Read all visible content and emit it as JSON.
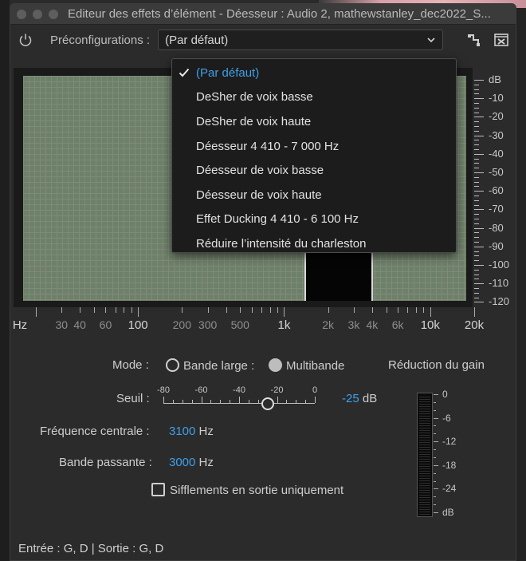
{
  "window": {
    "title": "Editeur des effets d’élément - Déesseur : Audio 2, mathewstanley_dec2022_S..."
  },
  "toolbar": {
    "presets_label": "Préconfigurations :",
    "selected_preset": "(Par défaut)"
  },
  "presets_menu": {
    "items": [
      {
        "label": "(Par défaut)",
        "selected": true
      },
      {
        "label": "DeSher de voix basse"
      },
      {
        "label": "DeSher de voix haute"
      },
      {
        "label": "Déesseur 4 410 - 7 000 Hz"
      },
      {
        "label": "Déesseur de voix basse"
      },
      {
        "label": "Déesseur de voix haute"
      },
      {
        "label": "Effet Ducking 4 410 - 6 100 Hz"
      },
      {
        "label": "Réduire l’intensité du charleston"
      }
    ]
  },
  "graph": {
    "db_labels": [
      "dB",
      "-10",
      "-20",
      "-30",
      "-40",
      "-50",
      "-60",
      "-70",
      "-80",
      "-90",
      "-100",
      "-110",
      "-120"
    ],
    "freq_labels": [
      {
        "text": "Hz",
        "major": true
      },
      {
        "text": "30",
        "major": false
      },
      {
        "text": "40",
        "major": false
      },
      {
        "text": "60",
        "major": false
      },
      {
        "text": "100",
        "major": true
      },
      {
        "text": "200",
        "major": false
      },
      {
        "text": "300",
        "major": false
      },
      {
        "text": "500",
        "major": false
      },
      {
        "text": "1k",
        "major": true
      },
      {
        "text": "2k",
        "major": false
      },
      {
        "text": "3k",
        "major": false
      },
      {
        "text": "4k",
        "major": false
      },
      {
        "text": "6k",
        "major": false
      },
      {
        "text": "10k",
        "major": true
      },
      {
        "text": "20k",
        "major": true
      }
    ]
  },
  "controls": {
    "mode_label": "Mode :",
    "broadband_label": "Bande large :",
    "multiband_label": "Multibande",
    "gain_reduction_label": "Réduction du gain",
    "threshold_label": "Seuil :",
    "threshold_scale": [
      "-80",
      "-60",
      "-40",
      "-20",
      "0"
    ],
    "threshold_value": "-25",
    "threshold_unit": "dB",
    "center_freq_label": "Fréquence centrale :",
    "center_freq_value": "3100",
    "center_freq_unit": "Hz",
    "bandwidth_label": "Bande passante :",
    "bandwidth_value": "3000",
    "bandwidth_unit": "Hz",
    "output_only_label": "Sifflements en sortie uniquement",
    "meter_labels": [
      "0",
      "-6",
      "-12",
      "-18",
      "-24",
      "dB"
    ]
  },
  "footer": {
    "io_text": "Entrée : G, D | Sortie : G, D"
  },
  "colors": {
    "accent": "#3ea0ea",
    "plot_fill": "#6f806a"
  }
}
